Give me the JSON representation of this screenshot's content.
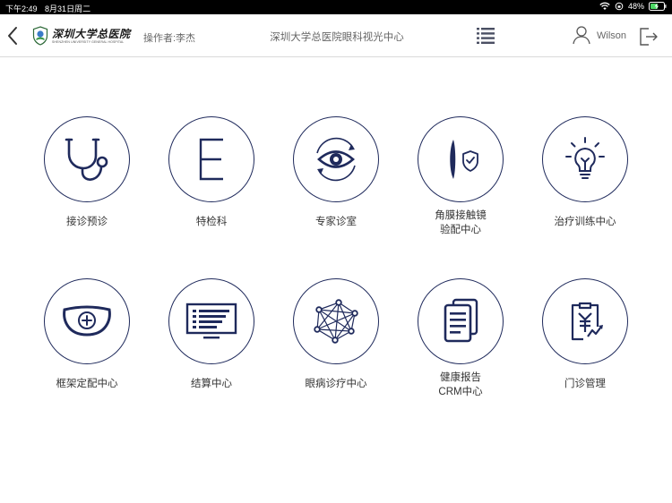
{
  "status_bar": {
    "time": "下午2:49",
    "date": "8月31日周二",
    "battery": "48%"
  },
  "nav": {
    "logo_cn": "深圳大学总医院",
    "logo_en": "SHENZHEN UNIVERSITY GENERAL HOSPITAL",
    "operator": "操作者:李杰",
    "title": "深圳大学总医院眼科视光中心",
    "user_name": "Wilson"
  },
  "modules": [
    {
      "label": "接诊预诊",
      "icon": "stethoscope-icon"
    },
    {
      "label": "特检科",
      "icon": "letter-e-icon"
    },
    {
      "label": "专家诊室",
      "icon": "eye-icon"
    },
    {
      "label": "角膜接触镜\n验配中心",
      "icon": "contact-lens-shield-icon"
    },
    {
      "label": "治疗训练中心",
      "icon": "lightbulb-icon"
    },
    {
      "label": "框架定配中心",
      "icon": "glasses-lens-icon"
    },
    {
      "label": "结算中心",
      "icon": "monitor-list-icon"
    },
    {
      "label": "眼病诊疗中心",
      "icon": "network-icon"
    },
    {
      "label": "健康报告\nCRM中心",
      "icon": "report-documents-icon"
    },
    {
      "label": "门诊管理",
      "icon": "yuan-clipboard-icon"
    }
  ],
  "colors": {
    "icon_stroke": "#1f2a5c",
    "statusbar_bg": "#000000",
    "battery_fill": "#4cd964"
  }
}
